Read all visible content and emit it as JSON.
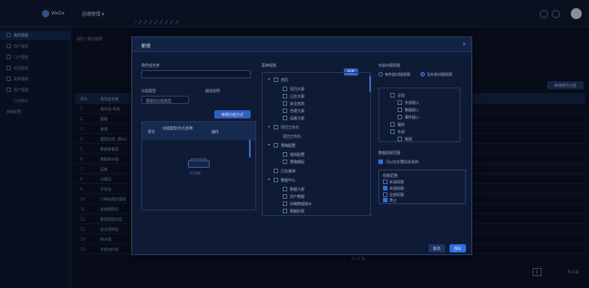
{
  "header": {
    "app_name": "WeDa",
    "system_title": "后端管理 ▾"
  },
  "sidebar": {
    "items": [
      {
        "label": "角色管理",
        "active": true
      },
      {
        "label": "用户管理",
        "active": false
      },
      {
        "label": "门户管理",
        "active": false
      },
      {
        "label": "应用管理",
        "active": false
      },
      {
        "label": "菜单管理",
        "active": false
      },
      {
        "label": "资产管理",
        "active": false
      },
      {
        "label": "日志审计",
        "active": false
      },
      {
        "label": "系统配置",
        "active": false
      }
    ]
  },
  "page": {
    "breadcrumb": "角色 / 角色管理",
    "add_button": "新增角色分组",
    "table_headers": [
      "序号",
      "角色组名称"
    ],
    "rows": [
      {
        "no": "1",
        "name": "角色组-系统"
      },
      {
        "no": "2",
        "name": "管理"
      },
      {
        "no": "3",
        "name": "普通"
      },
      {
        "no": "4",
        "name": "管理员组（默认）"
      },
      {
        "no": "5",
        "name": "数据查看组"
      },
      {
        "no": "6",
        "name": "数据审计组"
      },
      {
        "no": "7",
        "name": "运维"
      },
      {
        "no": "8",
        "name": "访客组"
      },
      {
        "no": "9",
        "name": "开发组"
      },
      {
        "no": "10",
        "name": "已审核角色管理"
      },
      {
        "no": "11",
        "name": "系统管理员"
      },
      {
        "no": "12",
        "name": "数据管理员组"
      },
      {
        "no": "13",
        "name": "安全保密组"
      },
      {
        "no": "14",
        "name": "审计组"
      },
      {
        "no": "15",
        "name": "外部协作组"
      }
    ],
    "bottom_text": "共 15 条",
    "pagination": {
      "current": "1",
      "total": "共15条"
    }
  },
  "dialog": {
    "title": "新增",
    "close": "×",
    "role_group_label": "角色组名称",
    "role_group_value": "",
    "type_label": "分组类型",
    "type_value": "管理员分组类型",
    "desc_label": "描述说明",
    "add_member_button": "新增分组方式",
    "mini_table_headers": [
      "序号",
      "分组类型/方式名称",
      "操作"
    ],
    "empty_text": "暂无数据",
    "perm_label": "菜单权限",
    "perm_search_button": "检索",
    "tree": [
      {
        "label": "首页",
        "level": 0,
        "arrow": "▾"
      },
      {
        "label": "项目大屏",
        "level": 1
      },
      {
        "label": "日志大屏",
        "level": 1
      },
      {
        "label": "安全态势",
        "level": 1
      },
      {
        "label": "合规大屏",
        "level": 1
      },
      {
        "label": "运维大屏",
        "level": 1
      },
      {
        "label": "项目工作台",
        "level": 0,
        "arrow": "▾"
      },
      {
        "label": "项目工作台",
        "level": 1
      },
      {
        "label": "策略配置",
        "level": 0,
        "arrow": "▾"
      },
      {
        "label": "规则配置",
        "level": 1
      },
      {
        "label": "策略模板",
        "level": 1
      },
      {
        "label": "日志查询",
        "level": 0
      },
      {
        "label": "数据中心",
        "level": 0,
        "arrow": "▾"
      },
      {
        "label": "数据大屏",
        "level": 1
      },
      {
        "label": "资产数据",
        "level": 1
      },
      {
        "label": "终端数据统计",
        "level": 1
      },
      {
        "label": "数据检索",
        "level": 1
      },
      {
        "label": "数据源",
        "level": 1
      }
    ],
    "scope_label": "外部对接权限",
    "scope_options": [
      "有外部对接权限",
      "无外部对接权限"
    ],
    "scope_selected": 1,
    "rtree": [
      {
        "label": "全局",
        "level": 0
      },
      {
        "label": "外部接入",
        "level": 1
      },
      {
        "label": "数据接入",
        "level": 1
      },
      {
        "label": "事件接入",
        "level": 1
      },
      {
        "label": "服务",
        "level": 0
      },
      {
        "label": "外部",
        "level": 0
      },
      {
        "label": "联网",
        "level": 1
      }
    ],
    "data_perm_label": "数据权限范围",
    "data_perm_checkbox": "可以在外置机关系构",
    "perm_box_title": "权限范围",
    "perm_box_items": [
      {
        "label": "本组权限",
        "checked": false
      },
      {
        "label": "本组权限",
        "checked": true
      },
      {
        "label": "全部权限",
        "checked": false
      },
      {
        "label": "禁止",
        "checked": true
      }
    ],
    "cancel_button": "取消",
    "ok_button": "保存"
  },
  "colors": {
    "accent": "#2f6fe0",
    "background": "#0b1326",
    "panel": "#0f1b34"
  }
}
